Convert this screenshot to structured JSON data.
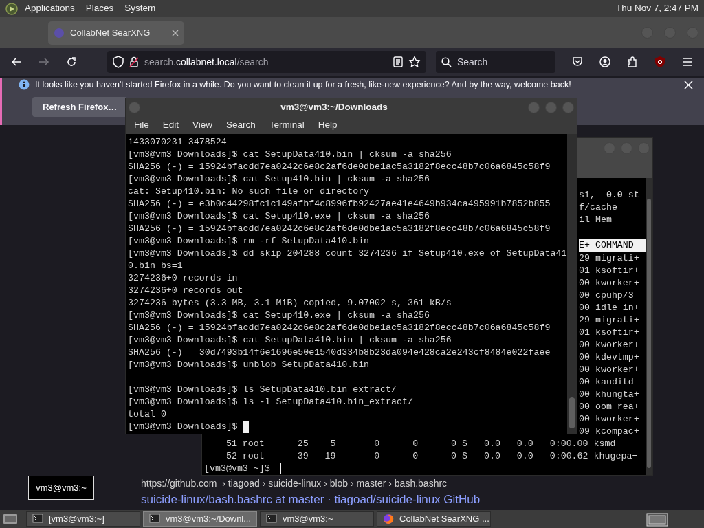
{
  "top_panel": {
    "menus": [
      "Applications",
      "Places",
      "System"
    ],
    "clock": "Thu Nov 7, 2:47 PM"
  },
  "browser": {
    "tabs": [
      {
        "label": "CollabNet SearXNG",
        "selected": true
      }
    ],
    "url": {
      "subdomain": "search.",
      "domain": "collabnet.local",
      "path": "/search"
    },
    "search": {
      "placeholder": "Search"
    },
    "notification": {
      "text": "It looks like you haven't started Firefox in a while. Do you want to clean it up for a fresh, like-new experience? And by the way, welcome back!",
      "button": "Refresh Firefox…"
    },
    "result": {
      "breadcrumb": "https://github.com  › tiagoad › suicide-linux › blob › master › bash.bashrc",
      "title": "suicide-linux/bash.bashrc at master · tiagoad/suicide-linux GitHub"
    }
  },
  "back_terminal": {
    "column_lines": [
      {
        "kind": "text",
        "text": "si,  **0.0** st"
      },
      {
        "kind": "text",
        "text": "f/cache"
      },
      {
        "kind": "text",
        "text": "il Mem"
      },
      {
        "kind": "blank"
      },
      {
        "kind": "header",
        "text": "E+ COMMAND"
      },
      {
        "kind": "text",
        "text": "29 migrati+"
      },
      {
        "kind": "text",
        "text": "01 ksoftir+"
      },
      {
        "kind": "text",
        "text": "00 kworker+"
      },
      {
        "kind": "text",
        "text": "00 cpuhp/3"
      },
      {
        "kind": "text",
        "text": "00 idle_in+"
      },
      {
        "kind": "text",
        "text": "29 migrati+"
      },
      {
        "kind": "text",
        "text": "01 ksoftir+"
      },
      {
        "kind": "text",
        "text": "00 kworker+"
      },
      {
        "kind": "text",
        "text": "00 kdevtmp+"
      },
      {
        "kind": "text",
        "text": "00 kworker+"
      },
      {
        "kind": "text",
        "text": "00 kauditd"
      },
      {
        "kind": "text",
        "text": "00 khungta+"
      },
      {
        "kind": "text",
        "text": "00 oom_rea+"
      },
      {
        "kind": "text",
        "text": "00 kworker+"
      },
      {
        "kind": "text",
        "text": "09 kcompac+"
      }
    ],
    "lines": [
      {
        "kind": "text",
        "text": "    51 root      25    5       0      0      0 S   0.0   0.0   0:00.00 ksmd"
      },
      {
        "kind": "text",
        "text": "    52 root      39   19       0      0      0 S   0.0   0.0   0:00.62 khugepa+"
      },
      {
        "kind": "prompt",
        "text": "[vm3@vm3 ~]$"
      }
    ]
  },
  "front_terminal": {
    "title": "vm3@vm3:~/Downloads",
    "menu": [
      "File",
      "Edit",
      "View",
      "Search",
      "Terminal",
      "Help"
    ],
    "lines": [
      {
        "kind": "text",
        "text": "1433070231 3478524"
      },
      {
        "kind": "text",
        "text": "[vm3@vm3 Downloads]$ cat SetupData410.bin | cksum -a sha256"
      },
      {
        "kind": "text",
        "text": "SHA256 (-) = 15924bfacdd7ea0242c6e8c2af6de0dbe1ac5a3182f8ecc48b7c06a6845c58f9"
      },
      {
        "kind": "text",
        "text": "[vm3@vm3 Downloads]$ cat Setup410.bin | cksum -a sha256"
      },
      {
        "kind": "text",
        "text": "cat: Setup410.bin: No such file or directory"
      },
      {
        "kind": "text",
        "text": "SHA256 (-) = e3b0c44298fc1c149afbf4c8996fb92427ae41e4649b934ca495991b7852b855"
      },
      {
        "kind": "text",
        "text": "[vm3@vm3 Downloads]$ cat Setup410.exe | cksum -a sha256"
      },
      {
        "kind": "text",
        "text": "SHA256 (-) = 15924bfacdd7ea0242c6e8c2af6de0dbe1ac5a3182f8ecc48b7c06a6845c58f9"
      },
      {
        "kind": "text",
        "text": "[vm3@vm3 Downloads]$ rm -rf SetupData410.bin"
      },
      {
        "kind": "text",
        "text": "[vm3@vm3 Downloads]$ dd skip=204288 count=3274236 if=Setup410.exe of=SetupData41"
      },
      {
        "kind": "text",
        "text": "0.bin bs=1"
      },
      {
        "kind": "text",
        "text": "3274236+0 records in"
      },
      {
        "kind": "text",
        "text": "3274236+0 records out"
      },
      {
        "kind": "text",
        "text": "3274236 bytes (3.3 MB, 3.1 MiB) copied, 9.07002 s, 361 kB/s"
      },
      {
        "kind": "text",
        "text": "[vm3@vm3 Downloads]$ cat Setup410.exe | cksum -a sha256"
      },
      {
        "kind": "text",
        "text": "SHA256 (-) = 15924bfacdd7ea0242c6e8c2af6de0dbe1ac5a3182f8ecc48b7c06a6845c58f9"
      },
      {
        "kind": "text",
        "text": "[vm3@vm3 Downloads]$ cat SetupData410.bin | cksum -a sha256"
      },
      {
        "kind": "text",
        "text": "SHA256 (-) = 30d7493b14f6e1696e50e1540d334b8b23da094e428ca2e243cf8484e022faee"
      },
      {
        "kind": "text",
        "text": "[vm3@vm3 Downloads]$ unblob SetupData410.bin"
      },
      {
        "kind": "blank"
      },
      {
        "kind": "text",
        "text": "[vm3@vm3 Downloads]$ ls SetupData410.bin_extract/"
      },
      {
        "kind": "text",
        "text": "[vm3@vm3 Downloads]$ ls -l SetupData410.bin_extract/"
      },
      {
        "kind": "text",
        "text": "total 0"
      },
      {
        "kind": "prompt",
        "text": "[vm3@vm3 Downloads]$"
      }
    ]
  },
  "tooltip": "vm3@vm3:~",
  "taskbar": [
    {
      "kind": "terminal",
      "label": "[vm3@vm3:~]",
      "selected": false
    },
    {
      "kind": "terminal",
      "label": "vm3@vm3:~/Downl...",
      "selected": true
    },
    {
      "kind": "terminal",
      "label": "vm3@vm3:~",
      "selected": false
    },
    {
      "kind": "browser",
      "label": "CollabNet SearXNG ...",
      "selected": false
    }
  ]
}
